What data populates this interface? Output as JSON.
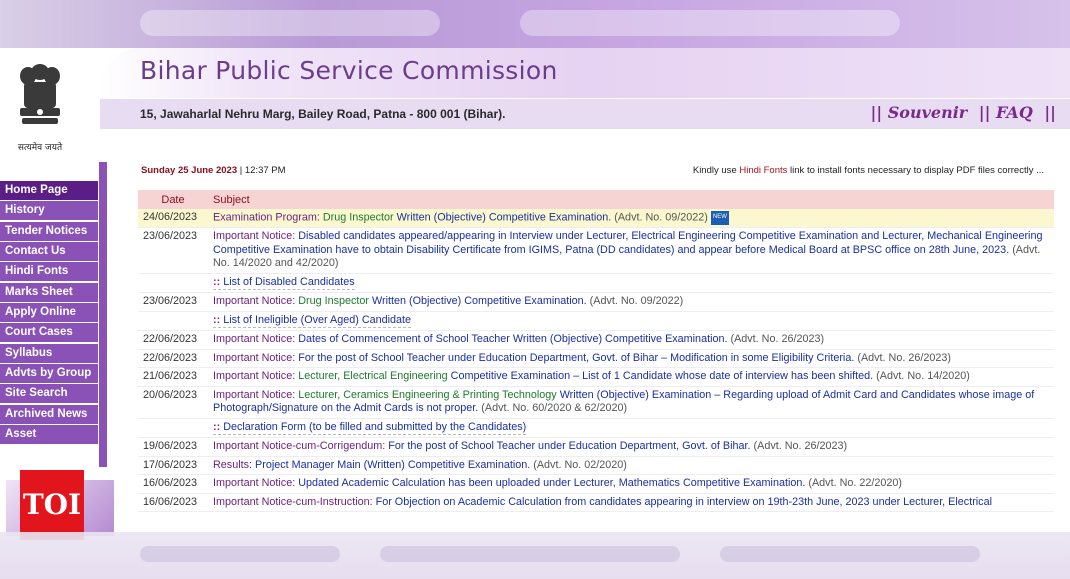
{
  "header": {
    "title": "Bihar Public Service Commission",
    "address": "15, Jawaharlal Nehru Marg, Bailey Road, Patna - 800 001 (Bihar).",
    "emblem_caption": "सत्यमेव जयते",
    "links": [
      "|| Souvenir",
      "|| FAQ",
      "||"
    ]
  },
  "nav": {
    "items": [
      "Home Page",
      "History",
      "Tender Notices",
      "Contact Us",
      "Hindi Fonts",
      "Marks Sheet",
      "Apply Online",
      "Court Cases",
      "Syllabus",
      "Advts by Group",
      "Site Search",
      "Archived News",
      "Asset Declaration"
    ],
    "active_index": 0
  },
  "dateline": {
    "date": "Sunday 25 June 2023",
    "sep": " | ",
    "time": "12:37 PM"
  },
  "font_note": {
    "prefix": "Kindly use ",
    "link": "Hindi Fonts",
    "suffix": " link to install fonts necessary to display PDF files correctly ..."
  },
  "table": {
    "headers": [
      "Date",
      "Subject"
    ],
    "new_badge": "NEW",
    "rows": [
      {
        "date": "24/06/2023",
        "label": "Examination Program: ",
        "green": "Drug Inspector ",
        "text": "Written (Objective) Competitive Examination.",
        "adv": " (Advt. No. 09/2022)",
        "highlight": true,
        "new": true
      },
      {
        "date": "23/06/2023",
        "label": "Important Notice: ",
        "green": "",
        "text": "Disabled candidates appeared/appearing in Interview under Lecturer, Electrical Engineering Competitive Examination and Lecturer, Mechanical Engineering Competitive Examination have to obtain Disability Certificate from IGIMS, Patna (DD candidates) and appear before Medical Board at BPSC office on 28th June, 2023.",
        "adv": " (Advt. No. 14/2020 and 42/2020)",
        "sub": "List of Disabled Candidates"
      },
      {
        "date": "23/06/2023",
        "label": "Important Notice: ",
        "green": "Drug Inspector ",
        "text": "Written (Objective) Competitive Examination.",
        "adv": " (Advt. No. 09/2022)",
        "sub": "List of Ineligible (Over Aged) Candidate"
      },
      {
        "date": "22/06/2023",
        "label": "Important Notice: ",
        "green": "",
        "text": "Dates of Commencement of School Teacher Written (Objective) Competitive Examination.",
        "adv": " (Advt. No. 26/2023)"
      },
      {
        "date": "22/06/2023",
        "label": "Important Notice: ",
        "green": "",
        "text": "For the post of School Teacher under Education Department, Govt. of Bihar – Modification in some Eligibility Criteria.",
        "adv": " (Advt. No. 26/2023)"
      },
      {
        "date": "21/06/2023",
        "label": "Important Notice: ",
        "green": "Lecturer, Electrical Engineering ",
        "text": "Competitive Examination – List of 1 Candidate whose date of interview has been shifted.",
        "adv": " (Advt. No. 14/2020)"
      },
      {
        "date": "20/06/2023",
        "label": "Important Notice: ",
        "green": "Lecturer, Ceramics Engineering & Printing Technology ",
        "text": "Written (Objective) Examination – Regarding upload of Admit Card and Candidates whose image of Photograph/Signature on the Admit Cards is not proper.",
        "adv": " (Advt. No. 60/2020 & 62/2020)",
        "sub": "Declaration Form (to be filled and submitted by the Candidates)"
      },
      {
        "date": "19/06/2023",
        "label": "Important Notice-cum-Corrigendum: ",
        "green": "",
        "text": "For the post of School Teacher under Education Department, Govt. of Bihar.",
        "adv": " (Advt. No. 26/2023)"
      },
      {
        "date": "17/06/2023",
        "label": "Results: ",
        "green": "",
        "text": "Project Manager Main (Written) Competitive Examination.",
        "adv": " (Advt. No. 02/2020)"
      },
      {
        "date": "16/06/2023",
        "label": "Important Notice: ",
        "green": "",
        "text": "Updated Academic Calculation has been uploaded under Lecturer, Mathematics Competitive Examination.",
        "adv": " (Advt. No. 22/2020)"
      },
      {
        "date": "16/06/2023",
        "label": "Important Notice-cum-Instruction: ",
        "green": "",
        "text": "For Objection on Academic Calculation from candidates appearing in interview on 19th-23th June, 2023 under Lecturer, Electrical",
        "adv": ""
      }
    ]
  },
  "watermark": {
    "text": "TOI"
  },
  "colors": {
    "nav": "#8a52b6",
    "nav_active": "#5a1e86",
    "title": "#6b3d8c",
    "header_row": "#f7d4d4",
    "highlight_row": "#fbf8d0"
  }
}
